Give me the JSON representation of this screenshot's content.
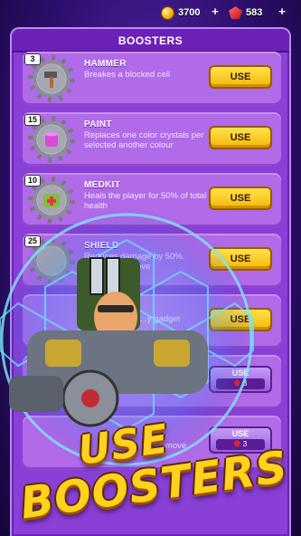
{
  "currency": {
    "coins": "3700",
    "gems": "583"
  },
  "panel": {
    "title": "BOOSTERS"
  },
  "boosters": [
    {
      "count": "3",
      "name": "HAMMER",
      "desc": "Breakes a blocked cell",
      "action": "USE",
      "icon": "hammer-icon"
    },
    {
      "count": "15",
      "name": "PAINT",
      "desc": "Replaces one color crystals per selected another colour",
      "action": "USE",
      "icon": "paint-bucket-icon"
    },
    {
      "count": "10",
      "name": "MEDKIT",
      "desc": "Heals the player for 50% of total health",
      "action": "USE",
      "icon": "medkit-icon"
    },
    {
      "count": "25",
      "name": "SHIELD",
      "desc": "Reduces damage by 50%. ...ponent to ...ove",
      "action": "USE",
      "icon": "shield-icon"
    },
    {
      "count": "",
      "name": "",
      "desc": "...y gadget",
      "action": "USE",
      "icon": "gadget-icon"
    },
    {
      "count": "",
      "name": "",
      "desc": "",
      "action": "USE",
      "price": "3",
      "icon": "booster-icon"
    },
    {
      "count": "",
      "name": "",
      "desc": "...move",
      "action": "USE",
      "price": "3",
      "icon": "booster-icon"
    }
  ],
  "promo": {
    "line1": "USE",
    "line2": "BOOSTERS"
  },
  "colors": {
    "accent": "#ffd21f",
    "panel": "#8a3fd6",
    "card": "#b16ae8",
    "button": "#f3b80b"
  }
}
